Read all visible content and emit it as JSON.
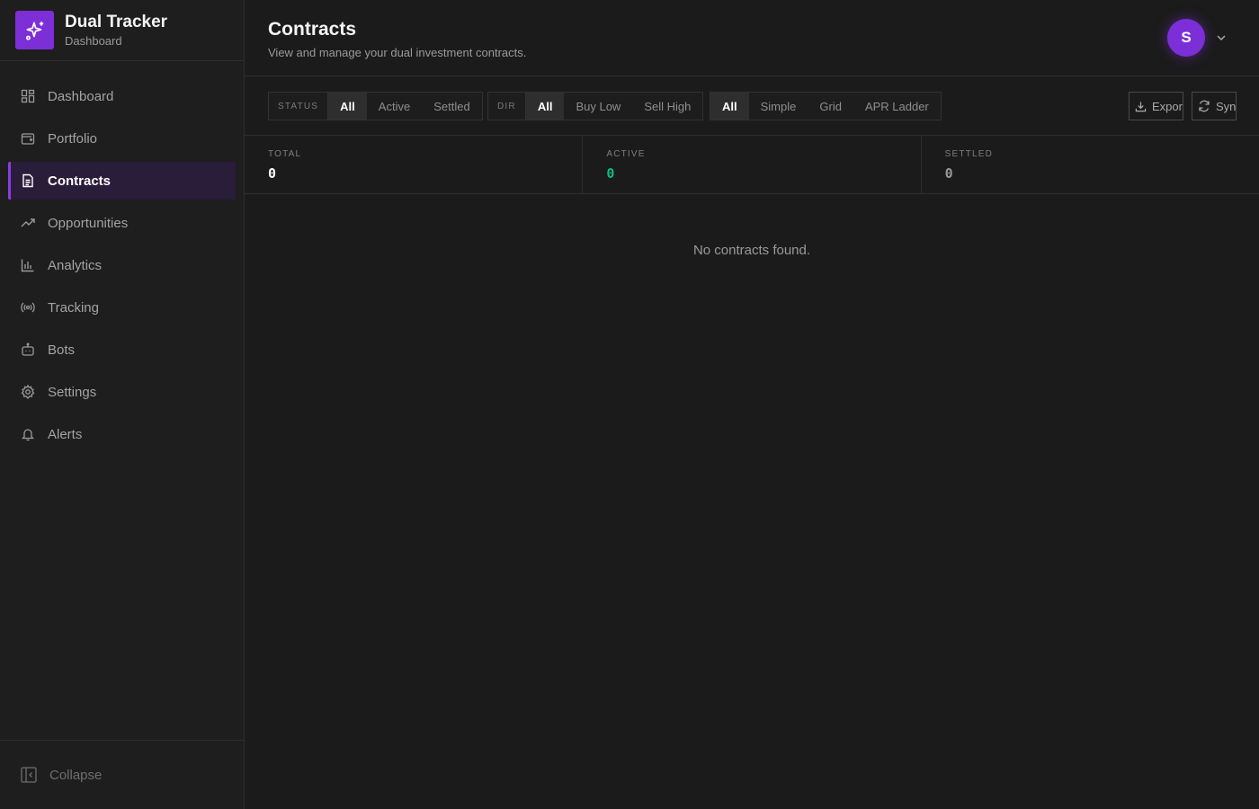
{
  "brand": {
    "title": "Dual Tracker",
    "subtitle": "Dashboard",
    "logo_icon": "sparkles-icon",
    "accent": "#7c2fd6"
  },
  "sidebar": {
    "items": [
      {
        "label": "Dashboard",
        "icon": "dashboard-icon",
        "active": false
      },
      {
        "label": "Portfolio",
        "icon": "wallet-icon",
        "active": false
      },
      {
        "label": "Contracts",
        "icon": "document-icon",
        "active": true
      },
      {
        "label": "Opportunities",
        "icon": "trending-up-icon",
        "active": false
      },
      {
        "label": "Analytics",
        "icon": "bar-chart-icon",
        "active": false
      },
      {
        "label": "Tracking",
        "icon": "radio-icon",
        "active": false
      },
      {
        "label": "Bots",
        "icon": "bot-icon",
        "active": false
      },
      {
        "label": "Settings",
        "icon": "gear-icon",
        "active": false
      },
      {
        "label": "Alerts",
        "icon": "bell-icon",
        "active": false
      }
    ],
    "collapse_label": "Collapse"
  },
  "header": {
    "title": "Contracts",
    "subtitle": "View and manage your dual investment contracts.",
    "avatar_initial": "S"
  },
  "filters": {
    "status": {
      "label": "STATUS",
      "options": [
        "All",
        "Active",
        "Settled"
      ],
      "selected": "All"
    },
    "dir": {
      "label": "DIR",
      "options": [
        "All",
        "Buy Low",
        "Sell High"
      ],
      "selected": "All"
    },
    "type": {
      "options": [
        "All",
        "Simple",
        "Grid",
        "APR Ladder"
      ],
      "selected": "All"
    }
  },
  "actions": {
    "export_label": "Export",
    "sync_label": "Sync"
  },
  "stats": [
    {
      "label": "TOTAL",
      "value": "0",
      "color": "#ffffff"
    },
    {
      "label": "ACTIVE",
      "value": "0",
      "color": "#10b981"
    },
    {
      "label": "SETTLED",
      "value": "0",
      "color": "#9a9a9a"
    }
  ],
  "empty_message": "No contracts found."
}
